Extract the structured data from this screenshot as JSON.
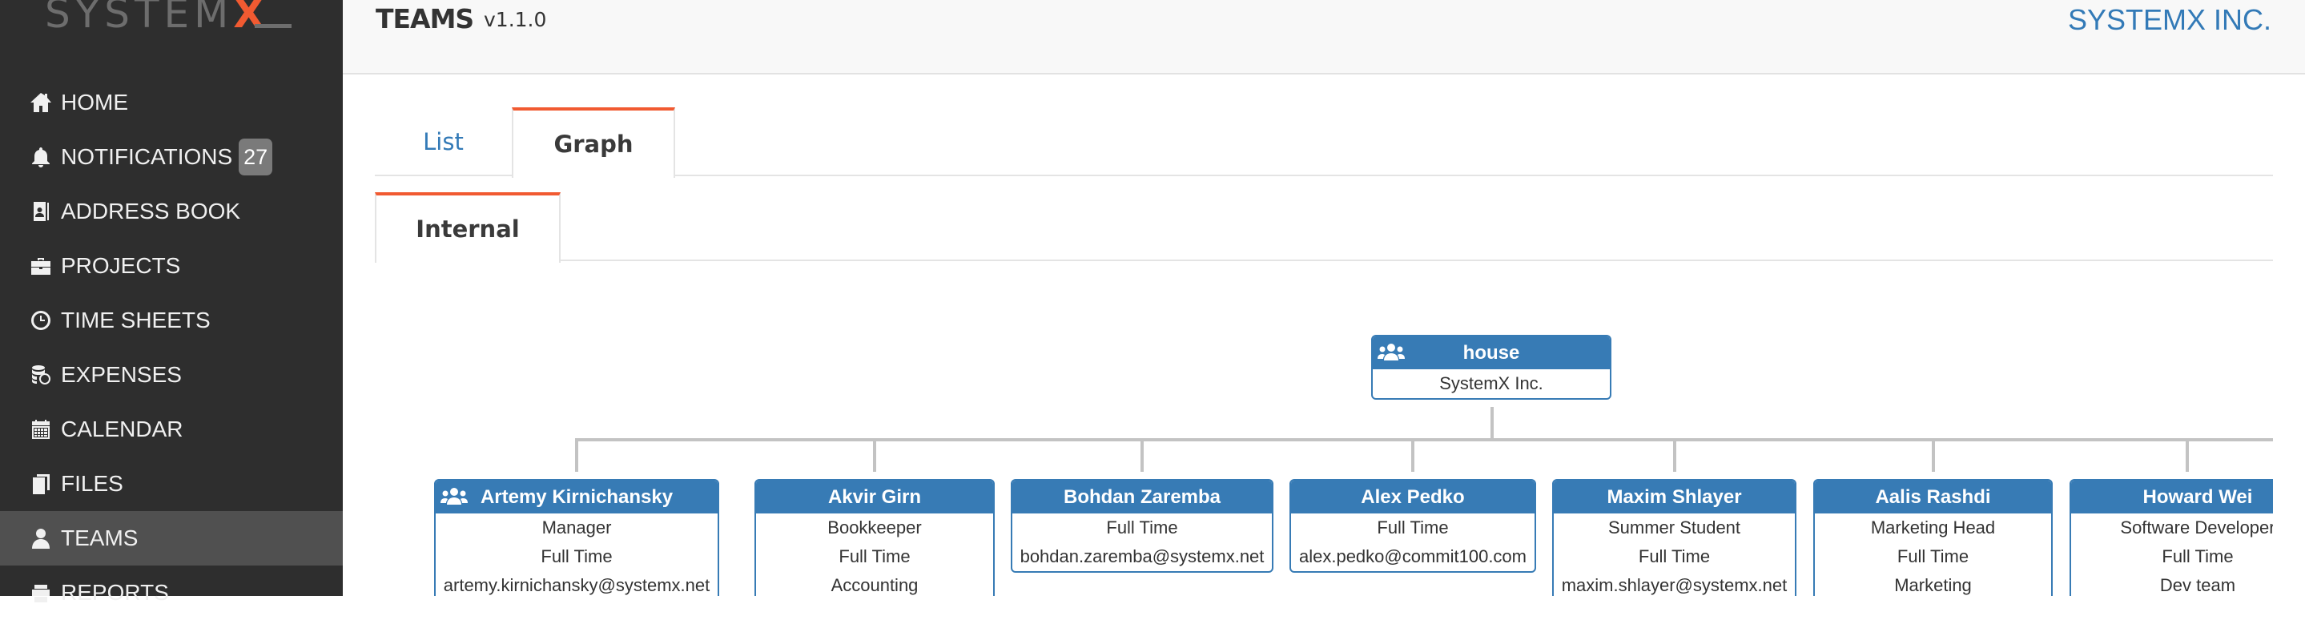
{
  "sidebar": {
    "logo": {
      "text": "SYSTEM",
      "accent": "X"
    },
    "items": [
      {
        "label": "HOME",
        "icon": "home-icon"
      },
      {
        "label": "NOTIFICATIONS",
        "icon": "bell-icon",
        "badge": "27"
      },
      {
        "label": "ADDRESS BOOK",
        "icon": "address-book-icon"
      },
      {
        "label": "PROJECTS",
        "icon": "briefcase-icon"
      },
      {
        "label": "TIME SHEETS",
        "icon": "clock-icon"
      },
      {
        "label": "EXPENSES",
        "icon": "coins-icon"
      },
      {
        "label": "CALENDAR",
        "icon": "calendar-icon"
      },
      {
        "label": "FILES",
        "icon": "files-icon"
      },
      {
        "label": "TEAMS",
        "icon": "user-icon",
        "active": true
      },
      {
        "label": "REPORTS",
        "icon": "reports-icon"
      }
    ]
  },
  "header": {
    "title": "TEAMS",
    "version": "v1.1.0",
    "company": "SYSTEMX INC."
  },
  "tabs": [
    {
      "label": "List",
      "active": false
    },
    {
      "label": "Graph",
      "active": true
    }
  ],
  "subtabs": [
    {
      "label": "Internal",
      "active": true
    }
  ],
  "colors": {
    "accent": "#f15a31",
    "brand": "#337ab7",
    "node": "#377bb5",
    "sidebar": "#2e2e2e",
    "sidebar_active": "#505050"
  },
  "org": {
    "root": {
      "title": "house",
      "lines": [
        "SystemX Inc."
      ],
      "group_icon": true
    },
    "children": [
      {
        "title": "Artemy Kirnichansky",
        "group_icon": true,
        "lines": [
          "Manager",
          "Full Time",
          "artemy.kirnichansky@systemx.net"
        ]
      },
      {
        "title": "Akvir Girn",
        "lines": [
          "Bookkeeper",
          "Full Time",
          "Accounting"
        ]
      },
      {
        "title": "Bohdan Zaremba",
        "lines": [
          "Full Time",
          "bohdan.zaremba@systemx.net"
        ]
      },
      {
        "title": "Alex Pedko",
        "lines": [
          "Full Time",
          "alex.pedko@commit100.com"
        ]
      },
      {
        "title": "Maxim Shlayer",
        "lines": [
          "Summer Student",
          "Full Time",
          "maxim.shlayer@systemx.net"
        ]
      },
      {
        "title": "Aalis Rashdi",
        "lines": [
          "Marketing Head",
          "Full Time",
          "Marketing"
        ]
      },
      {
        "title": "Howard Wei",
        "lines": [
          "Software Developer",
          "Full Time",
          "Dev team"
        ]
      }
    ]
  }
}
